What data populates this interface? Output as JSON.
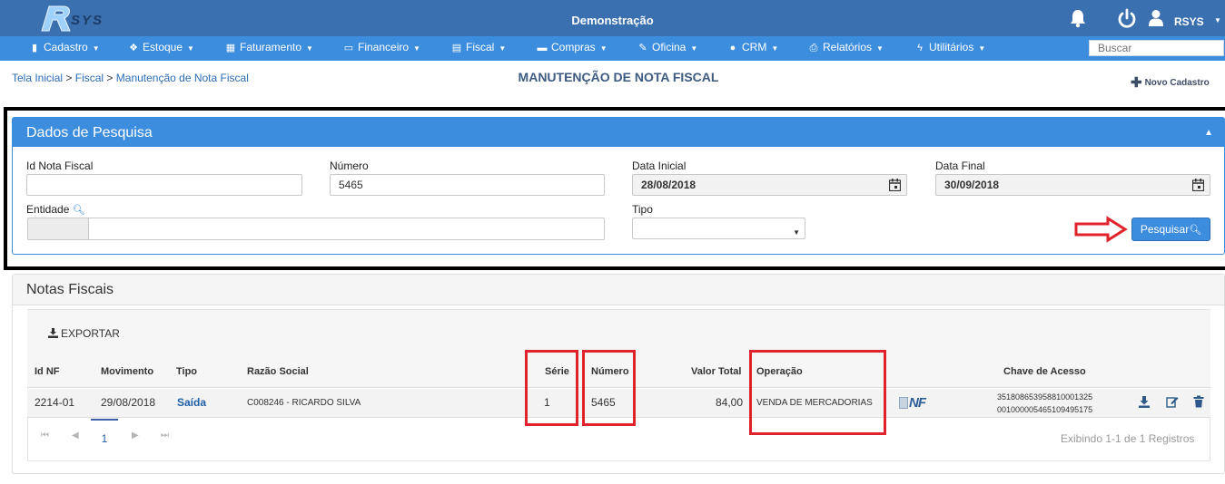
{
  "app": {
    "logo_text": "RSYS",
    "title": "Demonstração",
    "user": "RSYS",
    "icons": [
      "bell-icon",
      "power-icon",
      "user-icon"
    ]
  },
  "menu": {
    "items": [
      {
        "label": "Cadastro",
        "icon": "book-icon"
      },
      {
        "label": "Estoque",
        "icon": "cubes-icon"
      },
      {
        "label": "Faturamento",
        "icon": "calculator-icon"
      },
      {
        "label": "Financeiro",
        "icon": "money-icon"
      },
      {
        "label": "Fiscal",
        "icon": "document-icon"
      },
      {
        "label": "Compras",
        "icon": "truck-icon"
      },
      {
        "label": "Oficina",
        "icon": "wrench-icon"
      },
      {
        "label": "CRM",
        "icon": "users-icon"
      },
      {
        "label": "Relatórios",
        "icon": "print-icon"
      },
      {
        "label": "Utilitários",
        "icon": "bolt-icon"
      }
    ],
    "search_placeholder": "Buscar"
  },
  "breadcrumb": {
    "home": "Tela Inicial",
    "sep": ">",
    "level1": "Fiscal",
    "current": "Manutenção de Nota Fiscal"
  },
  "page": {
    "title": "MANUTENÇÃO DE NOTA FISCAL",
    "new_label": "Novo Cadastro"
  },
  "search": {
    "title": "Dados de Pesquisa",
    "fields": {
      "id_label": "Id Nota Fiscal",
      "id_value": "",
      "numero_label": "Número",
      "numero_value": "5465",
      "data_inicial_label": "Data Inicial",
      "data_inicial_value": "28/08/2018",
      "data_final_label": "Data Final",
      "data_final_value": "30/09/2018",
      "entidade_label": "Entidade",
      "entidade_value": "",
      "tipo_label": "Tipo",
      "tipo_value": ""
    },
    "button": "Pesquisar"
  },
  "notas": {
    "title": "Notas Fiscais",
    "export_label": "EXPORTAR",
    "columns": {
      "id": "Id NF",
      "movimento": "Movimento",
      "tipo": "Tipo",
      "razao": "Razão Social",
      "serie": "Série",
      "numero": "Número",
      "valor": "Valor Total",
      "operacao": "Operação",
      "chave": "Chave de Acesso"
    },
    "rows": [
      {
        "id": "2214-01",
        "movimento": "29/08/2018",
        "tipo": "Saída",
        "razao": "C008246 - RICARDO SILVA",
        "serie": "1",
        "numero": "5465",
        "valor": "84,00",
        "operacao": "VENDA DE MERCADORIAS",
        "nf_badge": "NF",
        "chave_line1": "35180865395881000132​5",
        "chave_line2": "001000005465109495175"
      }
    ],
    "pager": {
      "current_page": "1",
      "summary": "Exibindo 1-1 de 1 Registros"
    }
  },
  "colors": {
    "topbar": "#3a6fb0",
    "menubar": "#3c8dde",
    "accent": "#3c8dde",
    "annotation_red": "#e0222a"
  }
}
